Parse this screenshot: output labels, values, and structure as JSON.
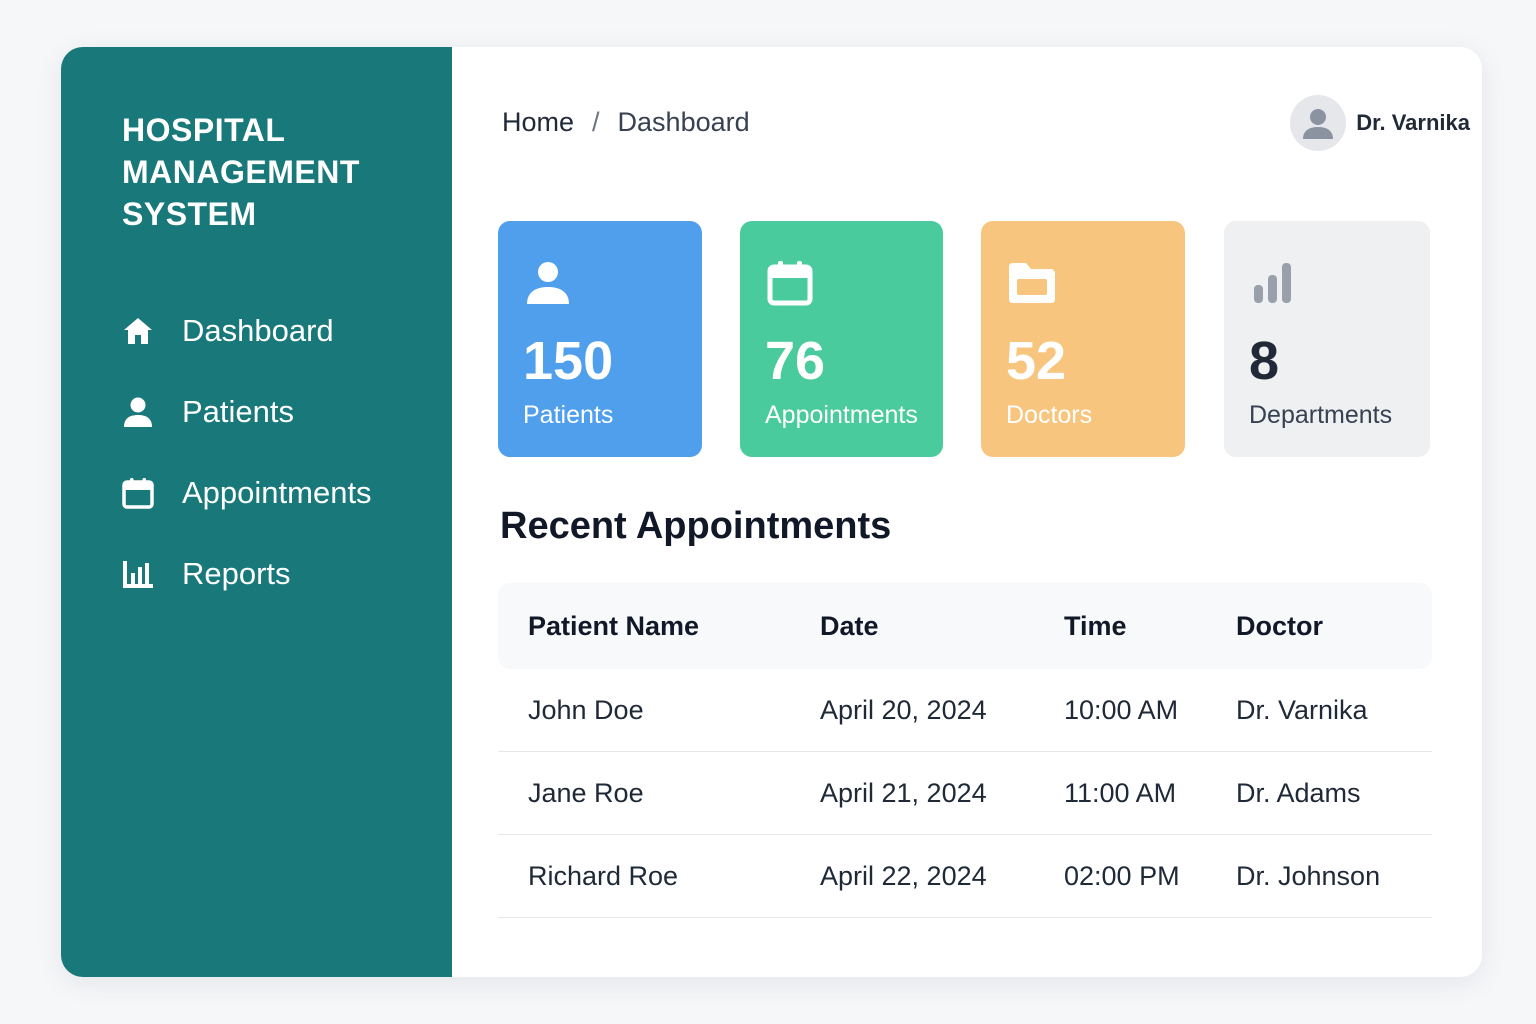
{
  "brand": {
    "lines": [
      "HOSPITAL",
      "MANAGEMENT",
      "SYSTEM"
    ]
  },
  "sidebar": {
    "items": [
      {
        "label": "Dashboard",
        "icon": "home-icon"
      },
      {
        "label": "Patients",
        "icon": "user-icon"
      },
      {
        "label": "Appointments",
        "icon": "calendar-icon"
      },
      {
        "label": "Reports",
        "icon": "bar-chart-icon"
      }
    ]
  },
  "breadcrumb": {
    "home": "Home",
    "separator": "/",
    "current": "Dashboard"
  },
  "user": {
    "name": "Dr. Varnika",
    "icon": "avatar-icon"
  },
  "stats": [
    {
      "value": "150",
      "label": "Patients",
      "icon": "user-icon",
      "color": "#4f9fec"
    },
    {
      "value": "76",
      "label": "Appointments",
      "icon": "calendar-icon",
      "color": "#4acb9e"
    },
    {
      "value": "52",
      "label": "Doctors",
      "icon": "folder-icon",
      "color": "#f8c57e"
    },
    {
      "value": "8",
      "label": "Departments",
      "icon": "bar-chart-icon",
      "color": "#eff0f2"
    }
  ],
  "recent": {
    "title": "Recent Appointments",
    "columns": [
      "Patient Name",
      "Date",
      "Time",
      "Doctor"
    ],
    "rows": [
      [
        "John Doe",
        "April 20, 2024",
        "10:00 AM",
        "Dr. Varnika"
      ],
      [
        "Jane Roe",
        "April 21, 2024",
        "11:00 AM",
        "Dr. Adams"
      ],
      [
        "Richard Roe",
        "April 22, 2024",
        "02:00 PM",
        "Dr. Johnson"
      ]
    ]
  },
  "colors": {
    "sidebar": "#19787a",
    "background": "#f6f7f9"
  }
}
